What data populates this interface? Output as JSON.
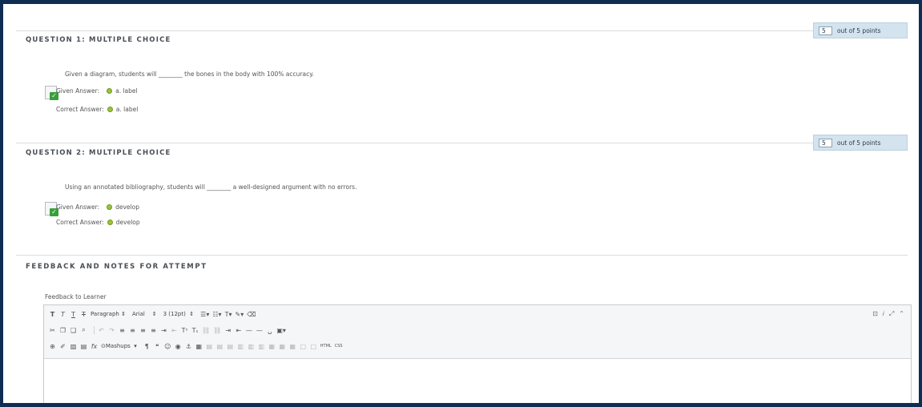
{
  "questions": [
    {
      "heading": "QUESTION 1:   MULTIPLE CHOICE",
      "points_value": "5",
      "points_suffix": "out of 5 points",
      "text": "Given a diagram, students will ________ the bones in the body with 100% accuracy.",
      "given_label": "Given Answer:",
      "given_answer": "a. label",
      "correct_label": "Correct Answer:",
      "correct_answer": "a. label"
    },
    {
      "heading": "QUESTION 2:   MULTIPLE CHOICE",
      "points_value": "5",
      "points_suffix": "out of 5 points",
      "text": "Using an annotated bibliography, students will ________ a well-designed argument with no errors.",
      "given_label": "Given Answer:",
      "given_answer": "develop",
      "correct_label": "Correct Answer:",
      "correct_answer": "develop"
    }
  ],
  "feedback": {
    "heading": "FEEDBACK AND NOTES FOR ATTEMPT",
    "label": "Feedback to Learner"
  },
  "editor": {
    "paragraph_select": "Paragraph",
    "font_select": "Arial",
    "size_select": "3 (12pt)",
    "mashups_label": "Mashups",
    "html_label": "HTML",
    "css_label": "CSS"
  },
  "colors": {
    "frame": "#0f2d52",
    "points_bg": "#d3e4ef",
    "correct_icon": "#38a03a"
  }
}
